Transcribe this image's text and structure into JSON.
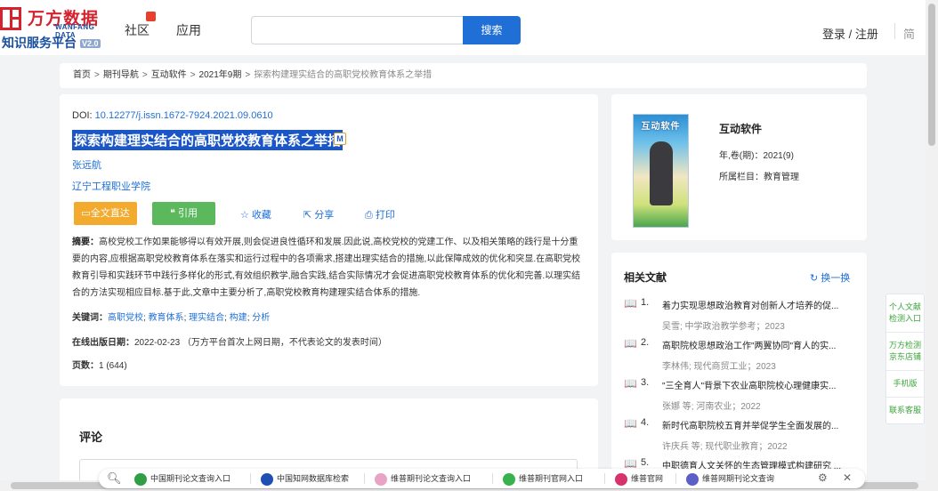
{
  "header": {
    "logo_cn": "万方数据",
    "logo_en": "WANFANG DATA",
    "logo_sub": "知识服务平台",
    "logo_ver": "V2.0",
    "nav": [
      "社区",
      "应用"
    ],
    "search_placeholder": "",
    "search_button": "搜索",
    "login": "登录 / 注册",
    "cut_text": "简"
  },
  "breadcrumb": {
    "items": [
      "首页",
      "期刊导航",
      "互动软件",
      "2021年9期"
    ],
    "separator": ">",
    "current": "探索构建理实结合的高职党校教育体系之举措"
  },
  "article": {
    "doi_label": "DOI: ",
    "doi": "10.12277/j.issn.1672-7924.2021.09.0610",
    "title": "探索构建理实结合的高职党校教育体系之举措",
    "title_icon": "M",
    "author": "张远航",
    "org": "辽宁工程职业学院",
    "btn_fulltext": "全文直达",
    "btn_cite": "引用",
    "action_fav": "收藏",
    "action_share": "分享",
    "action_print": "打印",
    "abstract_label": "摘要：",
    "abstract": "高校党校工作如果能够得以有效开展,则会促进良性循环和发展.因此说,高校党校的党建工作、以及相关策略的践行是十分重要的内容,应根据高职党校教育体系在落实和运行过程中的各项需求,搭建出理实结合的措施,以此保障成效的优化和突显.在高职党校教育引导和实践环节中践行多样化的形式,有效组织教学,融合实践,结合实际情况才会促进高职党校教育体系的优化和完善.以理实结合的方法实现相应目标.基于此,文章中主要分析了,高职党校教育构建理实结合体系的措施.",
    "keywords_label": "关键词：",
    "keywords": [
      "高职党校",
      "教育体系",
      "理实结合",
      "构建",
      "分析"
    ],
    "pubdate_label": "在线出版日期：",
    "pubdate": "2022-02-23",
    "pubdate_note": "（万方平台首次上网日期，不代表论文的发表时间）",
    "pages_label": "页数：",
    "pages": "1 (644)"
  },
  "comment": {
    "title": "评论"
  },
  "journal": {
    "cover_title": "互动软件",
    "name": "互动软件",
    "vol_label": "年,卷(期)：",
    "vol": "2021(9)",
    "col_label": "所属栏目：",
    "col": "教育管理"
  },
  "related": {
    "title": "相关文献",
    "refresh": "换一换",
    "items": [
      {
        "num": "1.",
        "title": "着力实现思想政治教育对创新人才培养的促...",
        "meta": "吴雪; 中学政治教学参考；2023"
      },
      {
        "num": "2.",
        "title": "高职院校思想政治工作\"两翼协同\"育人的实...",
        "meta": "李林伟; 现代商贸工业；2023"
      },
      {
        "num": "3.",
        "title": "\"三全育人\"背景下农业高职院校心理健康实...",
        "meta": "张娜  等;  河南农业；2022"
      },
      {
        "num": "4.",
        "title": "新时代高职院校五育并举促学生全面发展的...",
        "meta": "许庆兵  等;  现代职业教育；2022"
      },
      {
        "num": "5.",
        "title": "中职德育人文关怀的生态管理模式构建研究 ...",
        "meta": ""
      }
    ]
  },
  "sidebar": {
    "items": [
      "个人文献检测入口",
      "万方检测京东店铺",
      "手机版",
      "联系客服"
    ]
  },
  "quickbar": {
    "items": [
      {
        "label": "中国期刊论文查询入口",
        "color": "#2f9e44"
      },
      {
        "label": "中国知网数据库检索",
        "color": "#1f4fb3"
      },
      {
        "label": "维普期刊论文查询入口",
        "color": "#e9a3c4"
      },
      {
        "label": "维普期刊官网入口",
        "color": "#37b24d"
      },
      {
        "label": "维普官网",
        "color": "#d6336c"
      },
      {
        "label": "维普网期刊论文查询",
        "color": "#5b5fc7"
      }
    ]
  },
  "colors": {
    "accent": "#1f6fd6",
    "brand_red": "#d4232f",
    "btn_fulltext": "#f3ab2f",
    "btn_cite": "#5cb85c",
    "selection": "#1a56c7"
  }
}
